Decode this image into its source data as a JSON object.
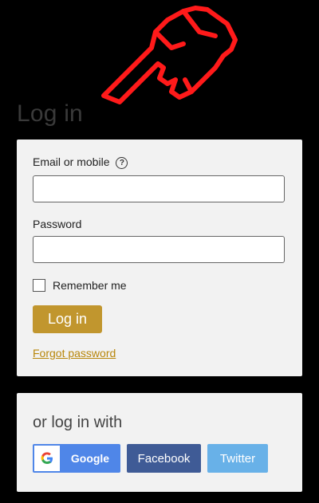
{
  "header": {
    "title": "Log in"
  },
  "login_form": {
    "email_label": "Email or mobile",
    "help_icon_glyph": "?",
    "email_value": "",
    "password_label": "Password",
    "password_value": "",
    "remember_label": "Remember me",
    "remember_checked": false,
    "login_button": "Log in",
    "forgot_link": "Forgot password"
  },
  "social": {
    "title": "or log in with",
    "google": "Google",
    "facebook": "Facebook",
    "twitter": "Twitter"
  },
  "colors": {
    "background": "#000000",
    "card": "#f2f2f2",
    "login_button": "#c1962e",
    "google": "#4f86e8",
    "facebook": "#3f5b96",
    "twitter": "#68b1e8",
    "annotation": "#ff0000"
  },
  "icons": {
    "annotation": "pointing-hand-icon",
    "help": "question-circle-icon",
    "google": "google-g-icon"
  }
}
